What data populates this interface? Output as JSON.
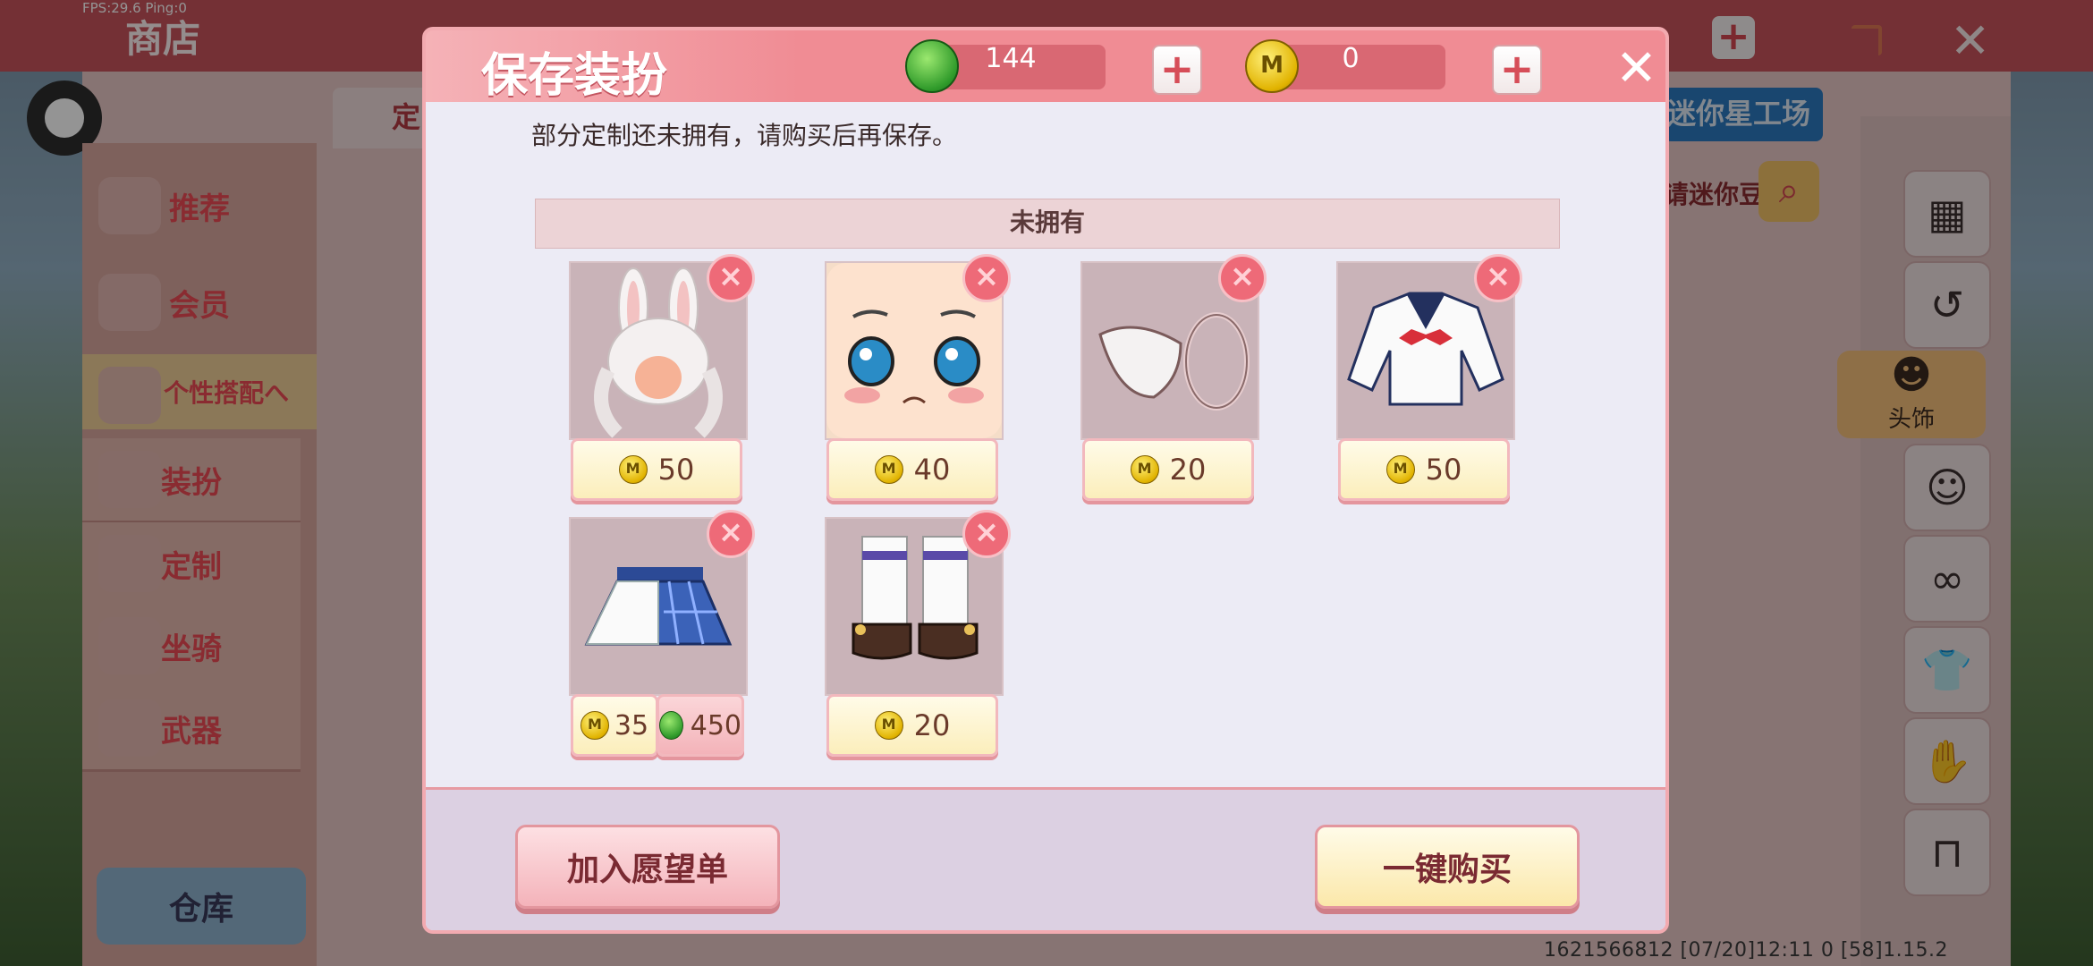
{
  "overlay": {
    "fps": "FPS:29.6  Ping:0"
  },
  "shop": {
    "title": "商店",
    "tab_partial": "定",
    "star_workshop": "迷你星工场",
    "search_hint": "请迷你豆",
    "footer_info": "1621566812   [07/20]12:11 0   [58]1.15.2"
  },
  "left_menu": {
    "items": [
      {
        "label": "推荐",
        "icon": "thumbs-up-icon"
      },
      {
        "label": "会员",
        "icon": "member-icon"
      },
      {
        "label": "个性搭配へ",
        "icon": "outfit-icon"
      },
      {
        "label": "装扮",
        "icon": "shirt-icon"
      },
      {
        "label": "定制",
        "icon": "custom-icon"
      },
      {
        "label": "坐骑",
        "icon": "mount-icon"
      },
      {
        "label": "武器",
        "icon": "gun-icon"
      }
    ],
    "warehouse": "仓库"
  },
  "right_menu": {
    "active_label": "头饰",
    "items": [
      "grid-icon",
      "history-icon",
      "head-icon",
      "face-icon",
      "mask-icon",
      "shirt-icon",
      "glove-icon",
      "pants-icon"
    ]
  },
  "dialog": {
    "title": "保存装扮",
    "gem_count": "144",
    "coin_count": "0",
    "coin_symbol": "M",
    "note": "部分定制还未拥有，请购买后再保存。",
    "section_title": "未拥有",
    "items": [
      {
        "name": "bunny-hair",
        "price": "50"
      },
      {
        "name": "shy-face",
        "price": "40"
      },
      {
        "name": "mask",
        "price": "20"
      },
      {
        "name": "sailor-shirt",
        "price": "50"
      },
      {
        "name": "plaid-skirt",
        "coin_price": "35",
        "gem_price": "450"
      },
      {
        "name": "socks-shoes",
        "price": "20"
      }
    ],
    "remove_symbol": "×",
    "wishlist_button": "加入愿望单",
    "buy_button": "一键购买"
  },
  "colors": {
    "accent": "#f08c94",
    "topbar": "#c9545c",
    "coin": "#e1b300",
    "gem": "#2f9a2a"
  }
}
